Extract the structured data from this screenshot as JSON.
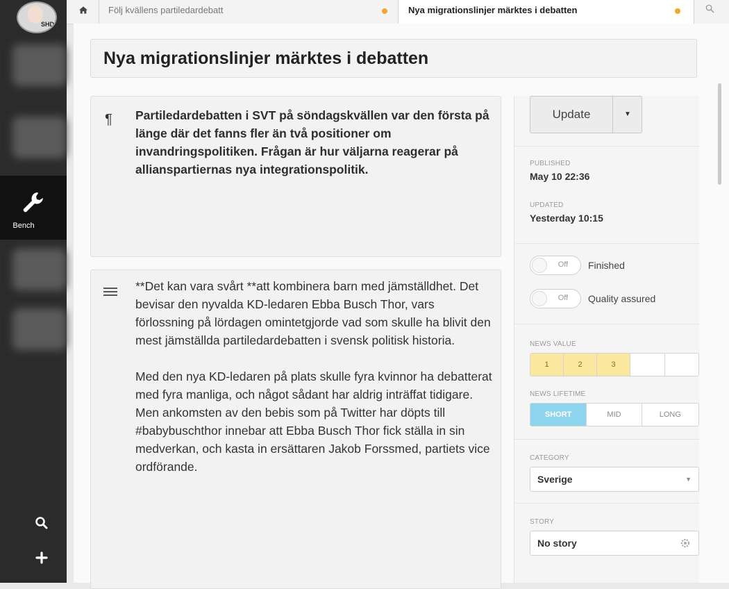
{
  "sidebar": {
    "avatar_badge": "SHD",
    "bench_label": "Bench",
    "icons": [
      "wrench-icon",
      "search-icon",
      "plus-icon"
    ]
  },
  "tabs": [
    {
      "label": "Följ kvällens partiledardebatt",
      "status_color": "#f0a534",
      "active": false
    },
    {
      "label": "Nya migrationslinjer märktes i debatten",
      "status_color": "#f0a534",
      "active": true
    }
  ],
  "article": {
    "title": "Nya migrationslinjer märktes i debatten",
    "lead": "Partiledardebatten i SVT på söndagskvällen var den första på länge där det fanns fler än två positioner om invandringspolitiken. Frågan är hur väljarna reagerar på allianspartiernas nya integrationspolitik.",
    "body": [
      "**Det kan vara svårt **att kombinera barn med jämställdhet. Det bevisar den nyvalda KD-ledaren Ebba Busch Thor, vars förlossning på lördagen omintetgjorde vad som skulle ha blivit den mest jämställda partiledardebatten i svensk politisk historia.",
      "Med den nya KD-ledaren på plats skulle fyra kvinnor ha debatterat med fyra manliga, och något sådant har aldrig inträffat tidigare. Men ankomsten av den bebis som på Twitter har döpts till #babybuschthor innebar att Ebba Busch Thor fick ställa in sin medverkan, och kasta in ersättaren Jakob Forssmed, partiets vice ordförande."
    ]
  },
  "panel": {
    "update_label": "Update",
    "published_label": "PUBLISHED",
    "published_value": "May 10 22:36",
    "updated_label": "UPDATED",
    "updated_value": "Yesterday 10:15",
    "toggles": [
      {
        "state": "Off",
        "label": "Finished"
      },
      {
        "state": "Off",
        "label": "Quality assured"
      }
    ],
    "news_value_label": "NEWS VALUE",
    "news_value_options": [
      "1",
      "2",
      "3",
      "",
      ""
    ],
    "news_value_selected": 3,
    "news_lifetime_label": "NEWS LIFETIME",
    "news_lifetime_options": [
      "SHORT",
      "MID",
      "LONG"
    ],
    "news_lifetime_selected": "SHORT",
    "category_label": "CATEGORY",
    "category_value": "Sverige",
    "story_label": "STORY",
    "story_value": "No story"
  },
  "colors": {
    "sidebar_bg": "#2b2b2b",
    "tab_status_dot": "#f0a534",
    "news_value_active": "#fbe79e",
    "news_lifetime_active": "#8fd4ee"
  }
}
